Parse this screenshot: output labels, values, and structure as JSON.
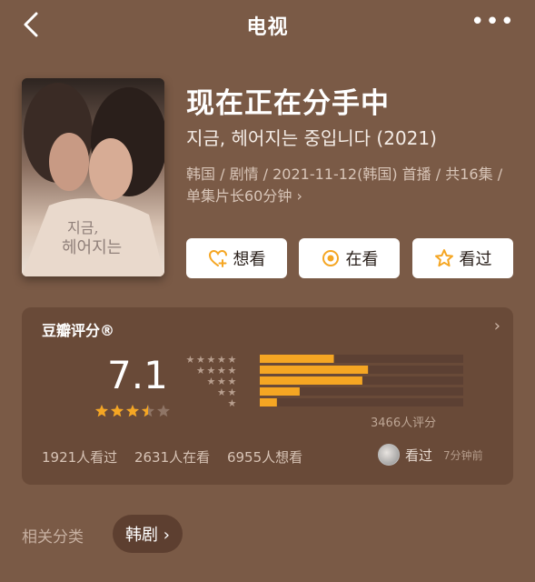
{
  "nav": {
    "title": "电视",
    "more_label": "•••",
    "back_icon": "chevron-left-icon"
  },
  "movie": {
    "title": "现在正在分手中",
    "original_title": "지금, 헤어지는 중입니다 (2021)",
    "meta": "韩国 / 剧情 / 2021-11-12(韩国) 首播 / 共16集 / 单集片长60分钟 ›"
  },
  "actions": {
    "want": "想看",
    "watching": "在看",
    "watched": "看过"
  },
  "rating": {
    "title": "豆瓣评分®",
    "score": "7.1",
    "stars_value": 3.5,
    "distribution_pct": [
      13,
      19,
      18,
      7,
      3
    ],
    "rating_count": "3466人评分",
    "stats": {
      "watched": "1921人看过",
      "watching": "2631人在看",
      "want": "6955人想看"
    },
    "friend_action": "看过",
    "friend_time": "7分钟前"
  },
  "category": {
    "label": "相关分类",
    "tag": "韩剧 ›"
  },
  "colors": {
    "accent": "#f5a623",
    "background": "#7a5a46",
    "card": "#694a38"
  }
}
